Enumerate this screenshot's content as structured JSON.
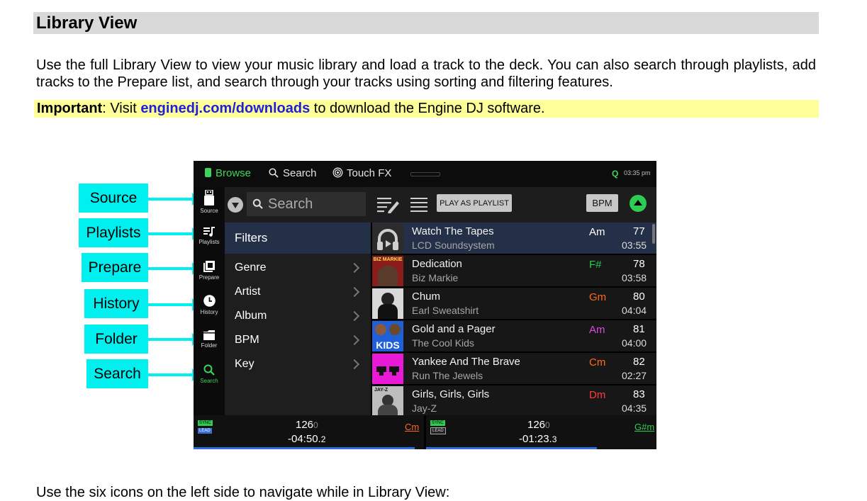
{
  "heading": "Library View",
  "paragraph": "Use the full Library View to view your music library and load a track to the deck. You can also search through playlists, add tracks to the Prepare list, and search through your tracks using sorting and filtering features.",
  "important": {
    "label": "Important",
    "pre": ": Visit ",
    "link": "enginedj.com/downloads",
    "post": " to download the Engine DJ software."
  },
  "callouts": [
    "Source",
    "Playlists",
    "Prepare",
    "History",
    "Folder",
    "Search"
  ],
  "screen": {
    "topbar": {
      "browse": "Browse",
      "search": "Search",
      "touch_fx": "Touch FX",
      "q_label": "Q",
      "time": "03:35 pm"
    },
    "sidebar": [
      "Source",
      "Playlists",
      "Prepare",
      "History",
      "Folder",
      "Search"
    ],
    "toolbar": {
      "search_placeholder": "Search",
      "play_as_playlist": "PLAY AS PLAYLIST",
      "bpm": "BPM"
    },
    "filters": {
      "title": "Filters",
      "items": [
        "Genre",
        "Artist",
        "Album",
        "BPM",
        "Key"
      ]
    },
    "tracks": [
      {
        "title": "Watch The Tapes",
        "artist": "LCD Soundsystem",
        "key": "Am",
        "key_color": "#ffffff",
        "bpm": "77",
        "duration": "03:55",
        "art_label": ""
      },
      {
        "title": "Dedication",
        "artist": "Biz Markie",
        "key": "F#",
        "key_color": "#2ecc52",
        "bpm": "78",
        "duration": "03:58",
        "art_label": "BIZ MARKIE"
      },
      {
        "title": "Chum",
        "artist": "Earl Sweatshirt",
        "key": "Gm",
        "key_color": "#ff6a1a",
        "bpm": "80",
        "duration": "04:04",
        "art_label": ""
      },
      {
        "title": "Gold and a Pager",
        "artist": "The Cool Kids",
        "key": "Am",
        "key_color": "#e04bd8",
        "bpm": "81",
        "duration": "04:00",
        "art_label": "KIDS"
      },
      {
        "title": "Yankee And The Brave",
        "artist": "Run The Jewels",
        "key": "Cm",
        "key_color": "#ff6a1a",
        "bpm": "82",
        "duration": "02:27",
        "art_label": ""
      },
      {
        "title": "Girls, Girls, Girls",
        "artist": "Jay-Z",
        "key": "Dm",
        "key_color": "#ff3b3b",
        "bpm": "83",
        "duration": "04:35",
        "art_label": "JAY-Z"
      }
    ],
    "stars": "★★★★★",
    "decks": [
      {
        "sync": "SYNC",
        "lead": "LEAD",
        "bpm_main": "126",
        "bpm_dec": "0",
        "time_main": "-04:50.",
        "time_dec": "2",
        "key": "Cm",
        "key_color": "#ff6a1a",
        "progress": 0.96
      },
      {
        "sync": "SYNC",
        "lead": "LEAD",
        "bpm_main": "126",
        "bpm_dec": "0",
        "time_main": "-01:23.",
        "time_dec": "3",
        "key": "G#m",
        "key_color": "#2ecc52",
        "progress": 0.74
      }
    ]
  },
  "bottom_text": "Use the six icons on the left side to navigate while in Library View:"
}
